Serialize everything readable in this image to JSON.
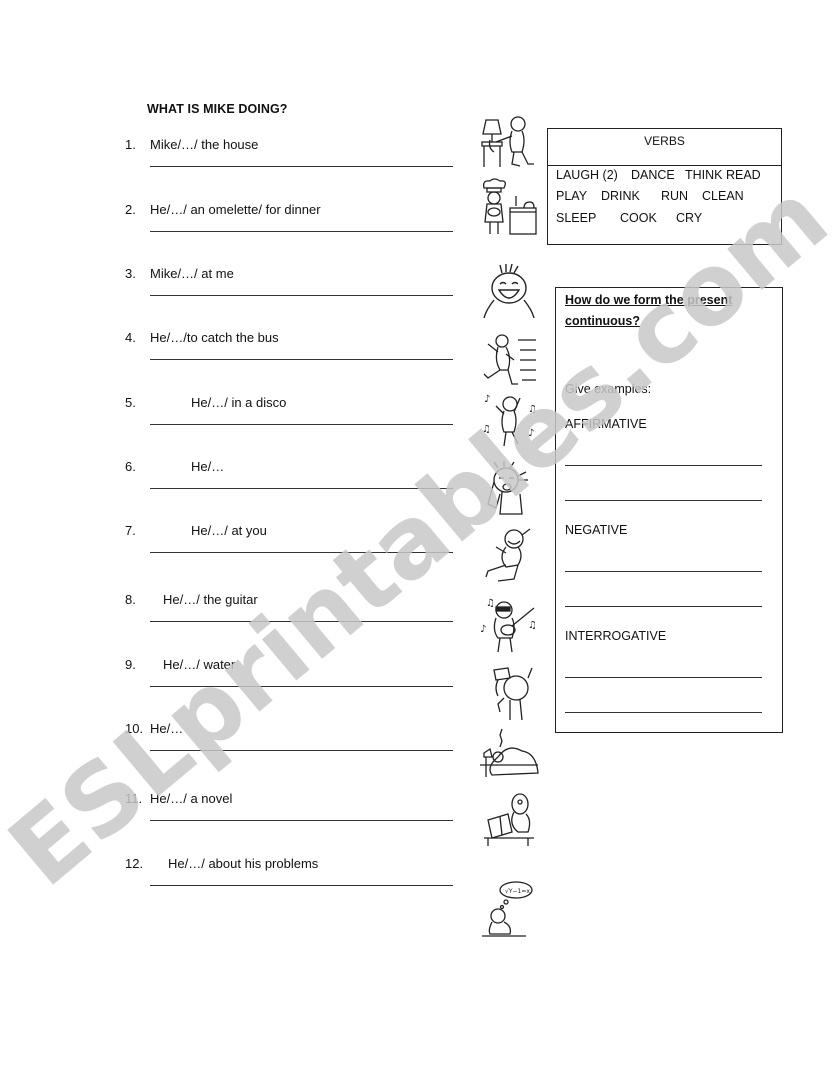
{
  "worksheet": {
    "title": "WHAT IS MIKE DOING?",
    "items": [
      {
        "num": "1.",
        "prompt": "Mike/…/ the house",
        "picture": "cleaning-icon"
      },
      {
        "num": "2.",
        "prompt": "He/…/ an omelette/ for dinner",
        "picture": "cooking-icon"
      },
      {
        "num": "3.",
        "prompt": "Mike/…/ at me",
        "picture": "laughing-icon"
      },
      {
        "num": "4.",
        "prompt": "He/…/to catch the bus",
        "picture": "running-icon"
      },
      {
        "num": "5.",
        "prompt": "He/…/ in a disco",
        "picture": "dancing-icon"
      },
      {
        "num": "6.",
        "prompt": "He/…",
        "picture": "crying-icon"
      },
      {
        "num": "7.",
        "prompt": "He/…/ at you",
        "picture": "laughing-on-floor-icon"
      },
      {
        "num": "8.",
        "prompt": "He/…/ the guitar",
        "picture": "guitar-icon"
      },
      {
        "num": "9.",
        "prompt": "He/…/ water",
        "picture": "drinking-icon"
      },
      {
        "num": "10.",
        "prompt": "He/…",
        "picture": "sleeping-icon"
      },
      {
        "num": "11.",
        "prompt": "He/…/ a novel",
        "picture": "reading-icon"
      },
      {
        "num": "12.",
        "prompt": "He/…/ about his problems",
        "picture": "thinking-icon"
      }
    ]
  },
  "verbs_box": {
    "title": "VERBS",
    "rows": [
      [
        "LAUGH (2)",
        "DANCE",
        "THINK READ"
      ],
      [
        "PLAY",
        "DRINK",
        "RUN",
        "CLEAN"
      ],
      [
        "SLEEP",
        "COOK",
        "CRY"
      ]
    ]
  },
  "grammar_box": {
    "question": "How do we form the present continuous?",
    "examples_label": "Give examples:",
    "sections": [
      {
        "label": "AFFIRMATIVE"
      },
      {
        "label": "NEGATIVE"
      },
      {
        "label": "INTERROGATIVE"
      }
    ]
  },
  "watermark": {
    "text": "ESLprintables.com",
    "color": "#c8c8c8"
  }
}
